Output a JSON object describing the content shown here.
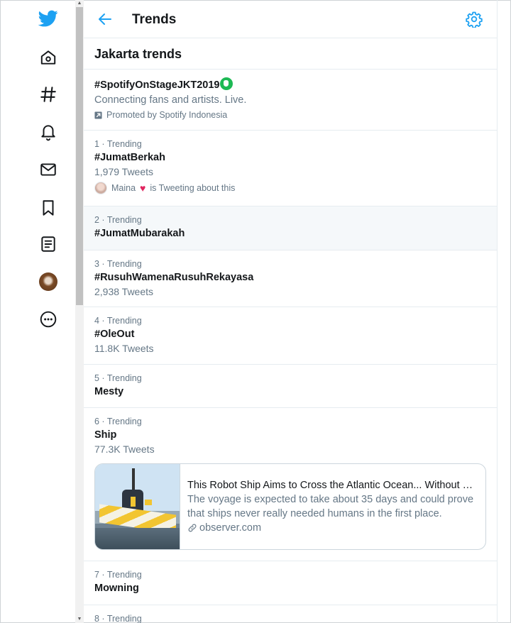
{
  "header": {
    "title": "Trends"
  },
  "section": {
    "title": "Jakarta trends"
  },
  "promoted": {
    "topic": "#SpotifyOnStageJKT2019",
    "description": "Connecting fans and artists. Live.",
    "promoted_by": "Promoted by Spotify Indonesia"
  },
  "trends": [
    {
      "meta": "1 · Trending",
      "topic": "#JumatBerkah",
      "count": "1,979 Tweets",
      "tweeting_user": "Maina",
      "tweeting_text": "is Tweeting about this"
    },
    {
      "meta": "2 · Trending",
      "topic": "#JumatMubarakah"
    },
    {
      "meta": "3 · Trending",
      "topic": "#RusuhWamenaRusuhRekayasa",
      "count": "2,938 Tweets"
    },
    {
      "meta": "4 · Trending",
      "topic": "#OleOut",
      "count": "11.8K Tweets"
    },
    {
      "meta": "5 · Trending",
      "topic": "Mesty"
    },
    {
      "meta": "6 · Trending",
      "topic": "Ship",
      "count": "77.3K Tweets"
    },
    {
      "meta": "7 · Trending",
      "topic": "Mowning"
    },
    {
      "meta": "8 · Trending"
    }
  ],
  "card": {
    "title": "This Robot Ship Aims to Cross the Atlantic Ocean... Without H...",
    "description": "The voyage is expected to take about 35 days and could prove that ships never really needed humans in the first place.",
    "domain": "observer.com"
  },
  "colors": {
    "accent": "#1da1f2",
    "text": "#14171a",
    "secondary": "#657786",
    "border": "#e6ecf0"
  }
}
